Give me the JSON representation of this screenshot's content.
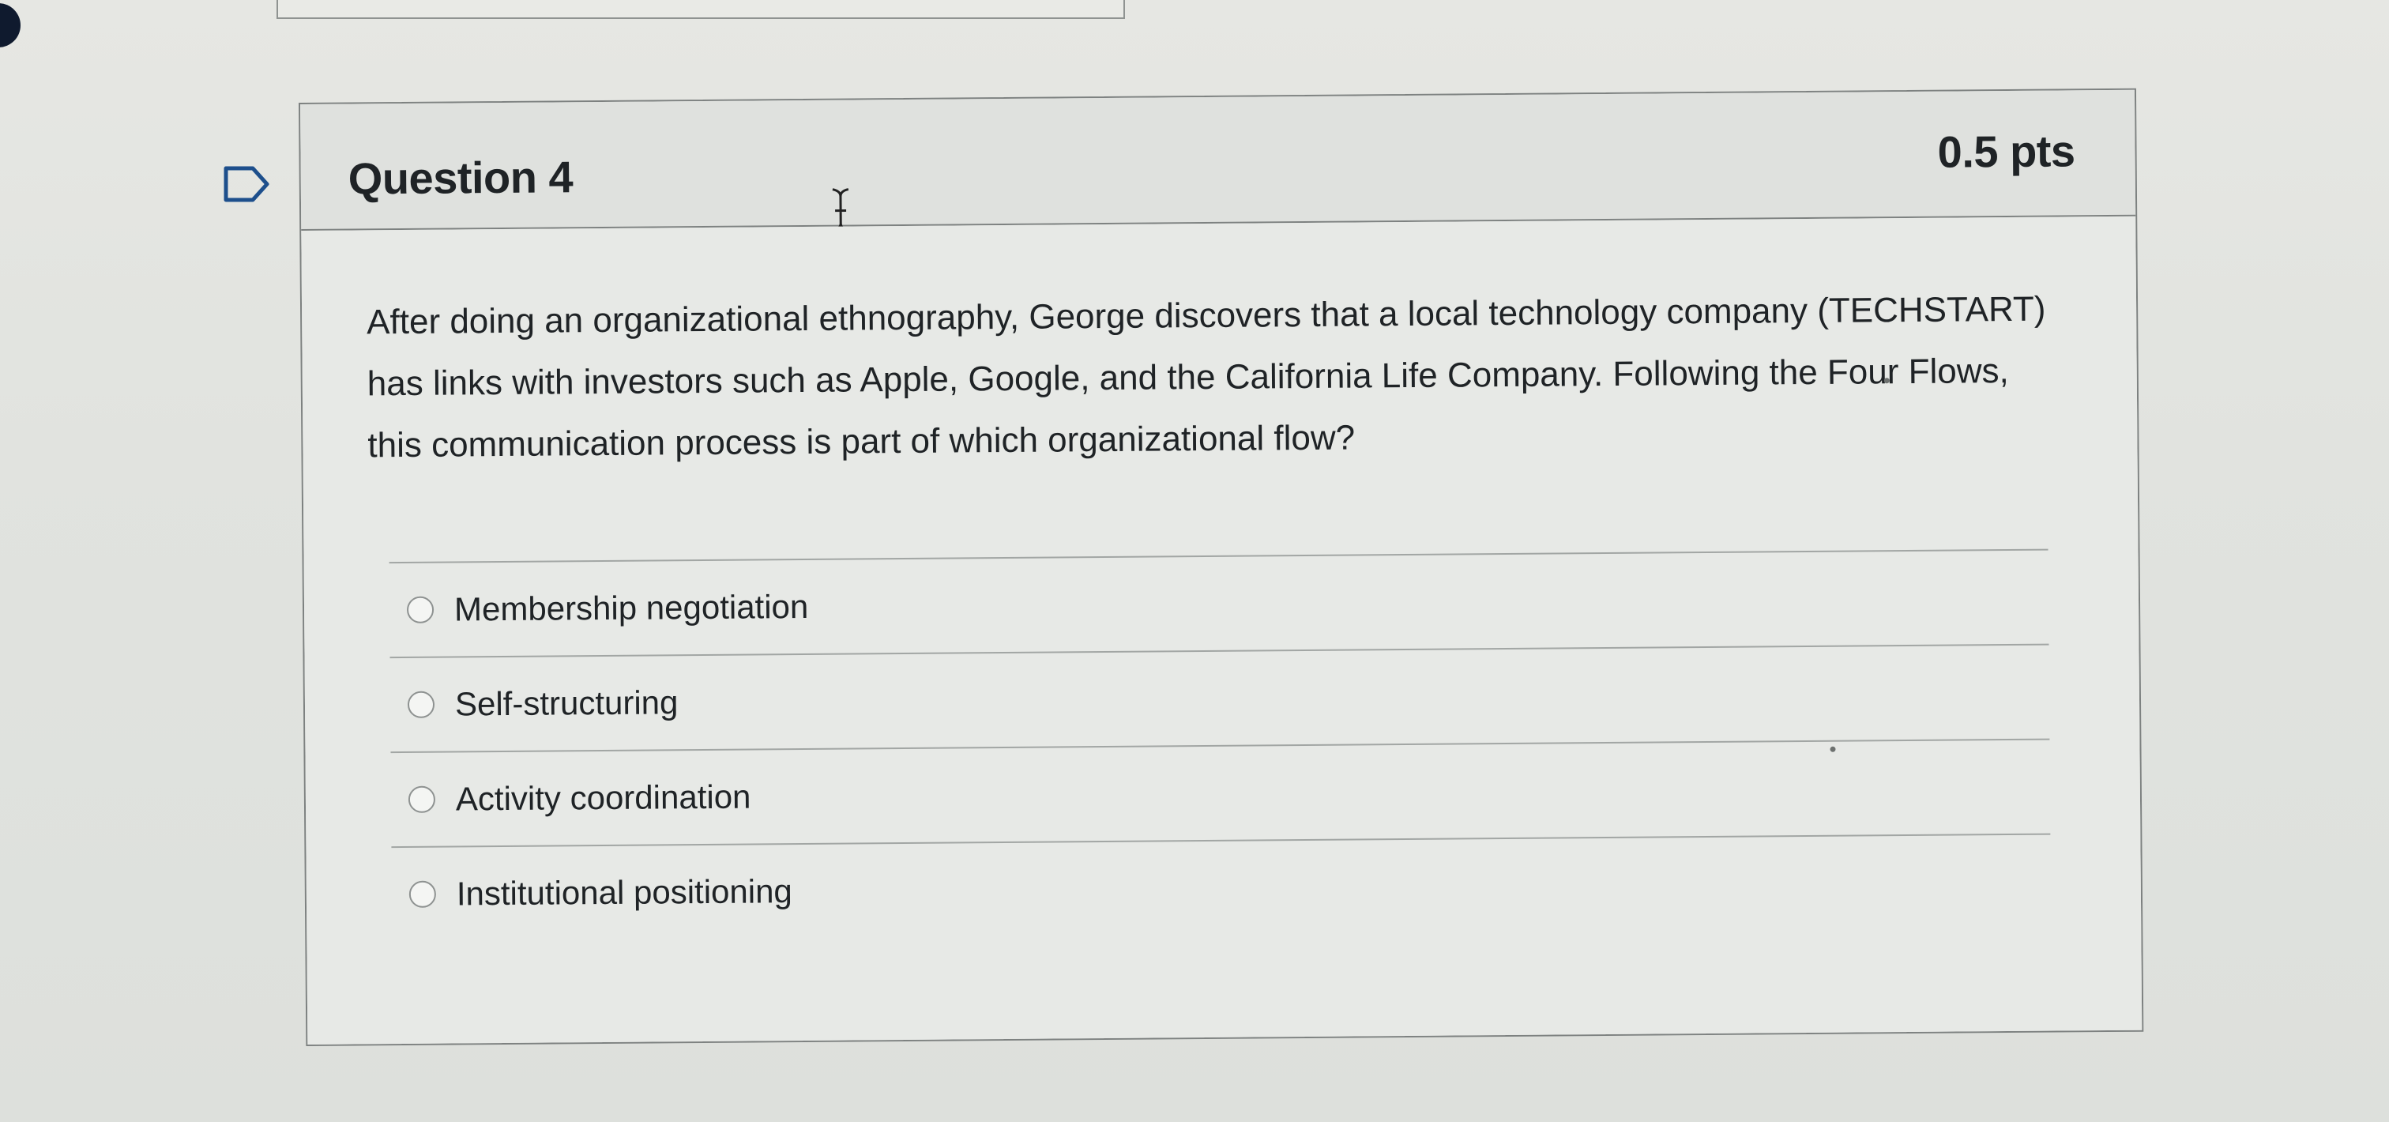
{
  "question": {
    "title": "Question 4",
    "points": "0.5 pts",
    "text": "After doing an organizational ethnography, George discovers that a local technology company (TECHSTART) has links with investors such as Apple, Google, and the California Life Company. Following the Four Flows, this communication process is part of which organizational flow?",
    "answers": [
      {
        "label": "Membership negotiation",
        "selected": false
      },
      {
        "label": "Self-structuring",
        "selected": false
      },
      {
        "label": "Activity coordination",
        "selected": false
      },
      {
        "label": "Institutional positioning",
        "selected": false
      }
    ]
  },
  "icons": {
    "flag": "flag-icon",
    "cursor": "text-cursor-icon",
    "radio": "radio-icon"
  },
  "colors": {
    "border": "#7d8180",
    "text": "#1f2326",
    "background": "#e5e7e4"
  }
}
